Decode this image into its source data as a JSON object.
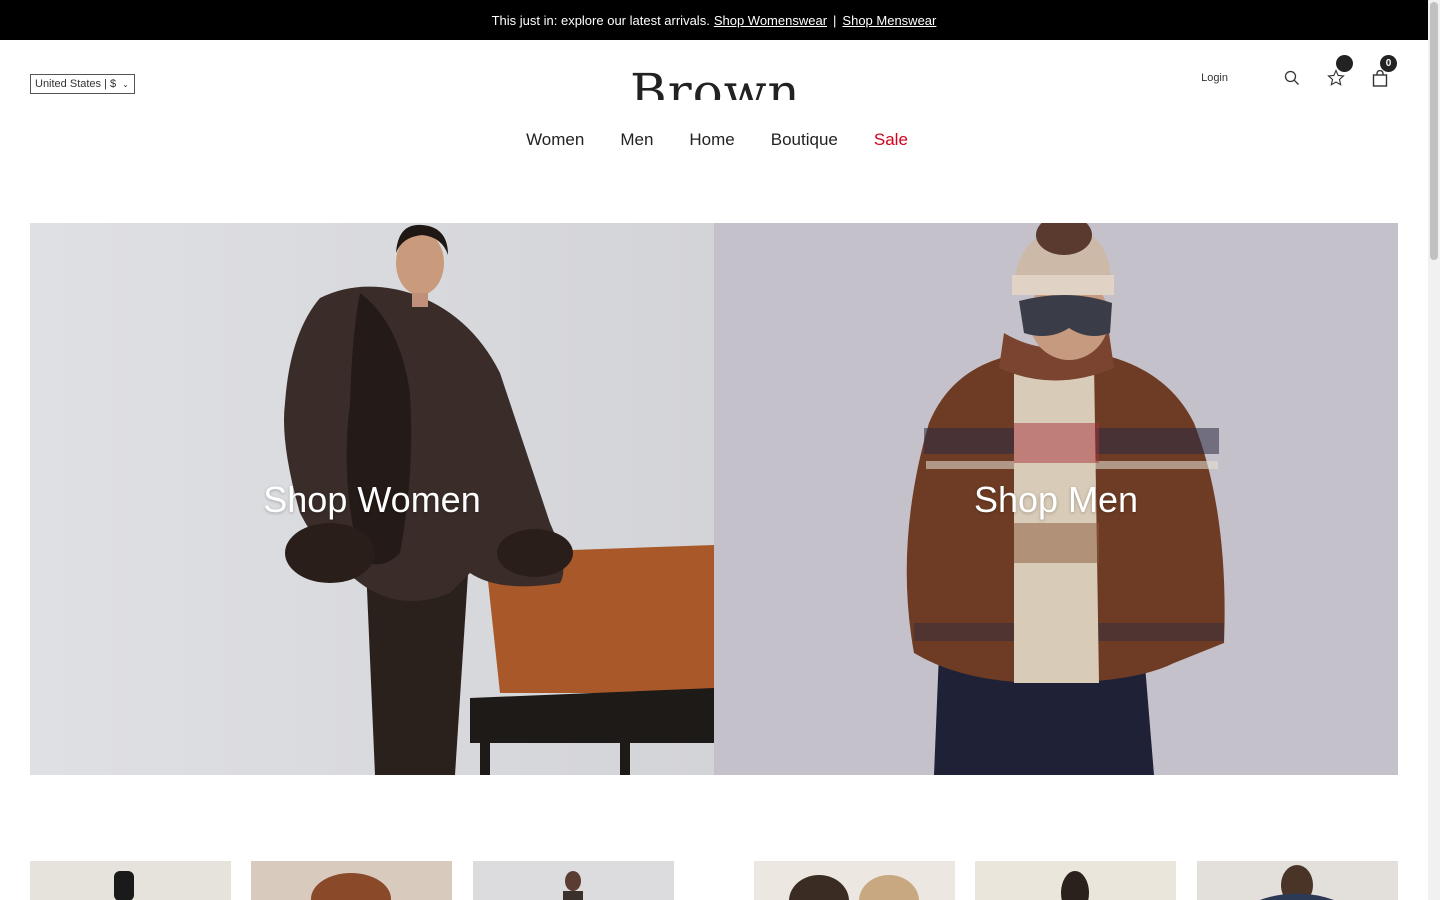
{
  "announcement": {
    "text": "This just in: explore our latest arrivals.",
    "link_women": "Shop Womenswear",
    "separator": "|",
    "link_men": "Shop Menswear"
  },
  "header": {
    "country": "United States | $",
    "logo": "Browns",
    "login": "Login",
    "wishlist_count": "",
    "cart_count": "0"
  },
  "nav": {
    "women": "Women",
    "men": "Men",
    "home": "Home",
    "boutique": "Boutique",
    "sale": "Sale"
  },
  "hero": {
    "women_label": "Shop Women",
    "men_label": "Shop Men"
  },
  "colors": {
    "sale": "#d0021b",
    "announcement_bg": "#000000"
  }
}
